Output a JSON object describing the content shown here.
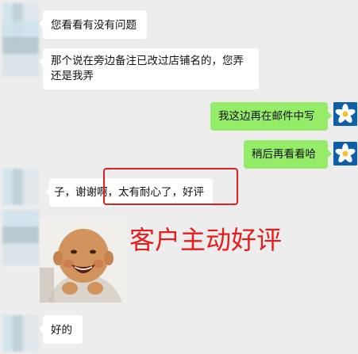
{
  "chat": {
    "messages": [
      {
        "side": "left",
        "text": "您看看有没有问题"
      },
      {
        "side": "left",
        "text": "那个说在旁边备注已改过店铺名的，您弄还是我弄"
      },
      {
        "side": "right",
        "text": "我这边再在邮件中写"
      },
      {
        "side": "right",
        "text": "稍后再看看哈"
      },
      {
        "side": "left",
        "text": "子，谢谢啊，太有耐心了，好评"
      },
      {
        "side": "left",
        "text": "好的"
      }
    ]
  },
  "annotation": {
    "text": "客户主动好评",
    "color": "#e81c1c"
  },
  "colors": {
    "background": "#ededed",
    "incoming_bubble": "#ffffff",
    "outgoing_bubble": "#95ec69",
    "highlight": "#e02020"
  },
  "icons": {
    "contact_avatar": "blurred-avatar-icon",
    "self_avatar": "flower-avatar-icon",
    "sticker": "baby-sticker-image"
  }
}
